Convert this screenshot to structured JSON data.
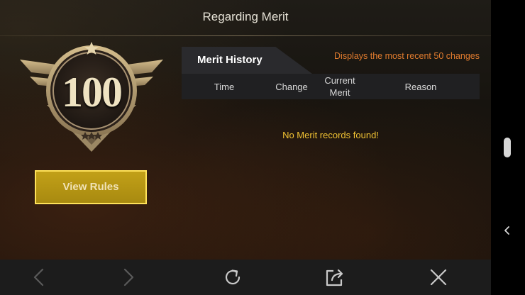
{
  "header": {
    "title": "Regarding Merit"
  },
  "badge": {
    "merit_value": "100"
  },
  "buttons": {
    "view_rules": "View Rules"
  },
  "history": {
    "tab_label": "Merit History",
    "recent_note": "Displays the most recent 50 changes",
    "columns": [
      "Time",
      "Change",
      "Current Merit",
      "Reason"
    ],
    "empty_message": "No Merit records found!"
  },
  "bottom_nav": {
    "items": [
      "back-icon",
      "forward-icon",
      "refresh-icon",
      "share-icon",
      "close-icon"
    ]
  },
  "colors": {
    "accent_gold": "#c2a018",
    "button_border": "#ffe25b",
    "note_orange": "#e07b2e",
    "empty_yellow": "#f0c233"
  }
}
